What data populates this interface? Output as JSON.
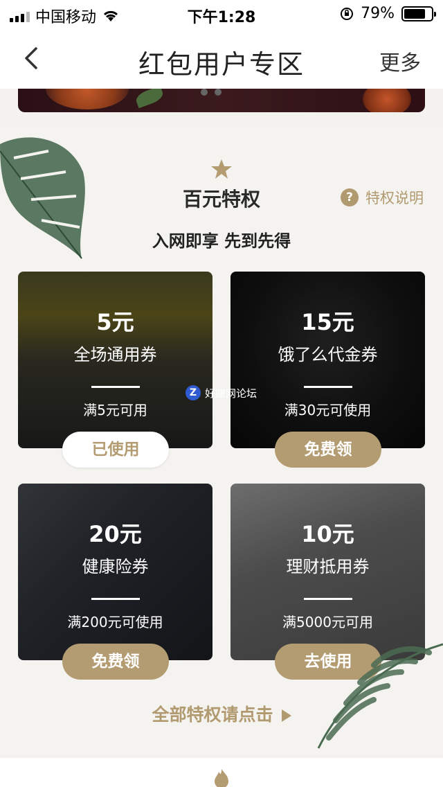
{
  "status_bar": {
    "carrier": "中国移动",
    "time": "下午1:28",
    "battery": "79%",
    "battery_level": 0.79
  },
  "nav": {
    "title": "红包用户专区",
    "more": "更多"
  },
  "section": {
    "title": "百元特权",
    "help_label": "特权说明",
    "subtitle": "入网即享 先到先得",
    "all_link": "全部特权请点击"
  },
  "cards": [
    {
      "amount": "5元",
      "name": "全场通用券",
      "condition": "满5元可用",
      "button": "已使用"
    },
    {
      "amount": "15元",
      "name": "饿了么代金券",
      "condition": "满30元可使用",
      "button": "免费领"
    },
    {
      "amount": "20元",
      "name": "健康险券",
      "condition": "满200元可使用",
      "button": "免费领"
    },
    {
      "amount": "10元",
      "name": "理财抵用券",
      "condition": "满5000元可用",
      "button": "去使用"
    }
  ],
  "watermark": "好赚网论坛",
  "colors": {
    "accent": "#b39c71",
    "leaf": "#4a6b52"
  }
}
